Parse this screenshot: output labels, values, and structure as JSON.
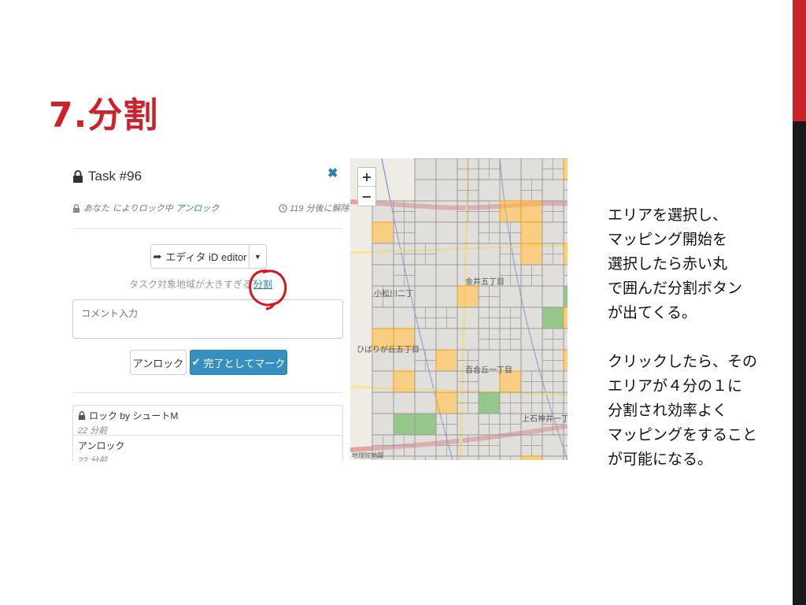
{
  "slide": {
    "title": "7.分割",
    "accent_color": "#cc2229"
  },
  "task_panel": {
    "title": "Task #96",
    "lock_icon": "lock-icon",
    "close_icon": "close-icon",
    "locked_by_prefix": "あなた",
    "locked_by_suffix": "によりロック中",
    "unlock_link": "アンロック",
    "timer_text": "119 分後に解除",
    "editor_button": "エディタ iD editor",
    "split_prefix": "タスク対象地域が大きすぎる？",
    "split_link": "分割",
    "split_suffix": "",
    "comment_placeholder": "コメント入力",
    "unlock_button": "アンロック",
    "mark_done_button": "完了としてマーク",
    "history": [
      {
        "title": "ロック by シュートM",
        "time": "22 分前",
        "icon": "lock-icon"
      },
      {
        "title": "アンロック",
        "time": "22 分前",
        "icon": ""
      }
    ],
    "link_color": "#2d7fb0",
    "primary_color": "#3590bf"
  },
  "map": {
    "zoom_in": "+",
    "zoom_out": "−",
    "labels": [
      "小松川二丁",
      "ひばりが丘五丁目",
      "金井五丁目",
      "百合丘一丁目",
      "上石神井一丁"
    ],
    "attribution": "地理院地図"
  },
  "description": {
    "paragraph1": [
      "エリアを選択し、",
      "マッピング開始を",
      "選択したら赤い丸",
      "で囲んだ分割ボタン",
      "が出てくる。"
    ],
    "paragraph2": [
      "クリックしたら、その",
      "エリアが４分の１に",
      "分割され効率よく",
      "マッピングをすること",
      "が可能になる。"
    ]
  }
}
